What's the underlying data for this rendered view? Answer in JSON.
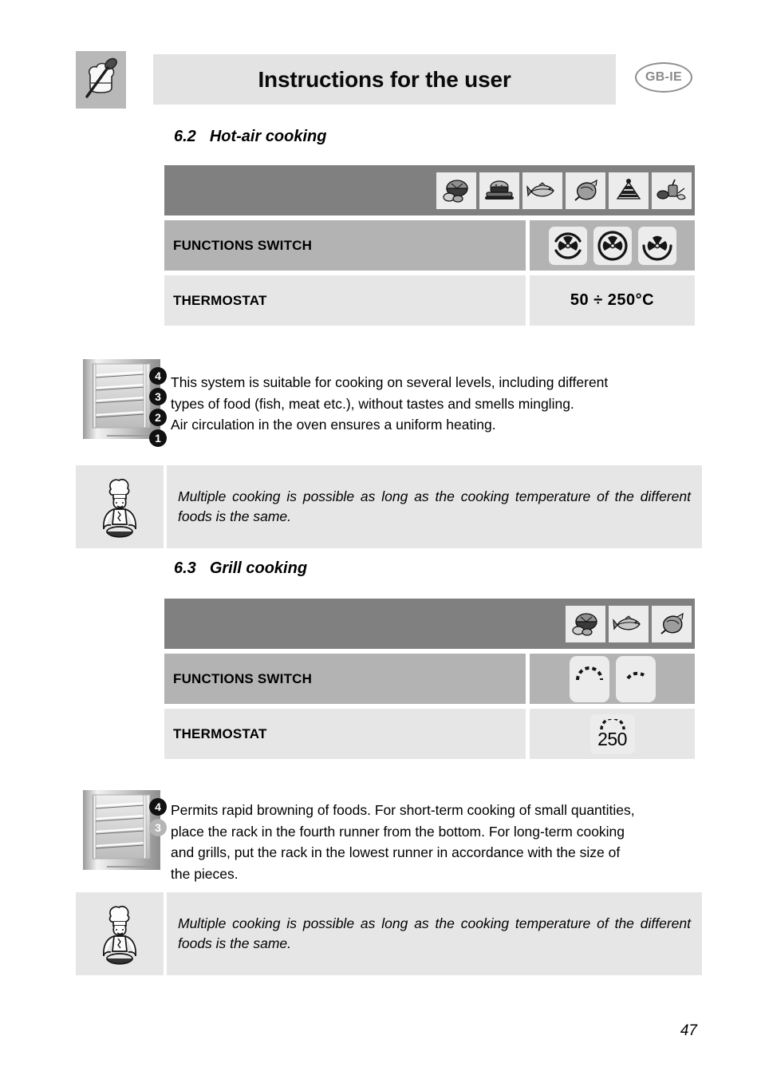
{
  "header": {
    "title": "Instructions for the user",
    "language_badge": "GB-IE",
    "icon": "chef-hat-spoon-icon"
  },
  "sections": [
    {
      "number": "6.2",
      "title": "Hot-air cooking",
      "food_icons": [
        "meat-icon",
        "roast-loaf-icon",
        "fish-icon",
        "chicken-icon",
        "cake-icon",
        "vegetables-icon"
      ],
      "rows": [
        {
          "label": "FUNCTIONS SWITCH",
          "value_type": "switch-icons",
          "icons": [
            "fan-heat-top-bottom-icon",
            "fan-circular-icon",
            "fan-heat-bottom-icon"
          ]
        },
        {
          "label": "THERMOSTAT",
          "value_type": "text",
          "value": "50 ÷ 250°C"
        }
      ],
      "rack_levels": [
        "4",
        "3",
        "2",
        "1"
      ],
      "rack_dim_levels": [],
      "body_lines": [
        "This system is suitable for cooking on several levels, including different",
        "types of food (fish, meat etc.), without tastes and smells mingling.",
        "Air circulation in the oven ensures a uniform heating."
      ],
      "note": "Multiple cooking is possible as long as the cooking temperature of the different foods is the same."
    },
    {
      "number": "6.3",
      "title": "Grill cooking",
      "food_icons": [
        "meat-icon",
        "fish-icon",
        "chicken-icon"
      ],
      "rows": [
        {
          "label": "FUNCTIONS SWITCH",
          "value_type": "switch-icons",
          "icons": [
            "grill-full-icon",
            "grill-half-icon"
          ]
        },
        {
          "label": "THERMOSTAT",
          "value_type": "thermo-icon",
          "value": "250"
        }
      ],
      "rack_levels": [
        "4",
        "3"
      ],
      "rack_dim_levels": [
        "3"
      ],
      "body_lines": [
        "Permits rapid browning of foods. For short-term cooking of small quantities,",
        "place the rack in the fourth runner from the bottom. For long-term cooking",
        "and grills, put the rack in the lowest runner in accordance with the size of",
        "the pieces."
      ],
      "note": "Multiple cooking is possible as long as the cooking temperature of the different foods is the same."
    }
  ],
  "footer": {
    "page_number": "47"
  },
  "colors": {
    "dark_gray": "#808080",
    "mid_gray": "#b3b3b3",
    "light_gray": "#e6e6e6",
    "icon_tile": "#ececec"
  }
}
